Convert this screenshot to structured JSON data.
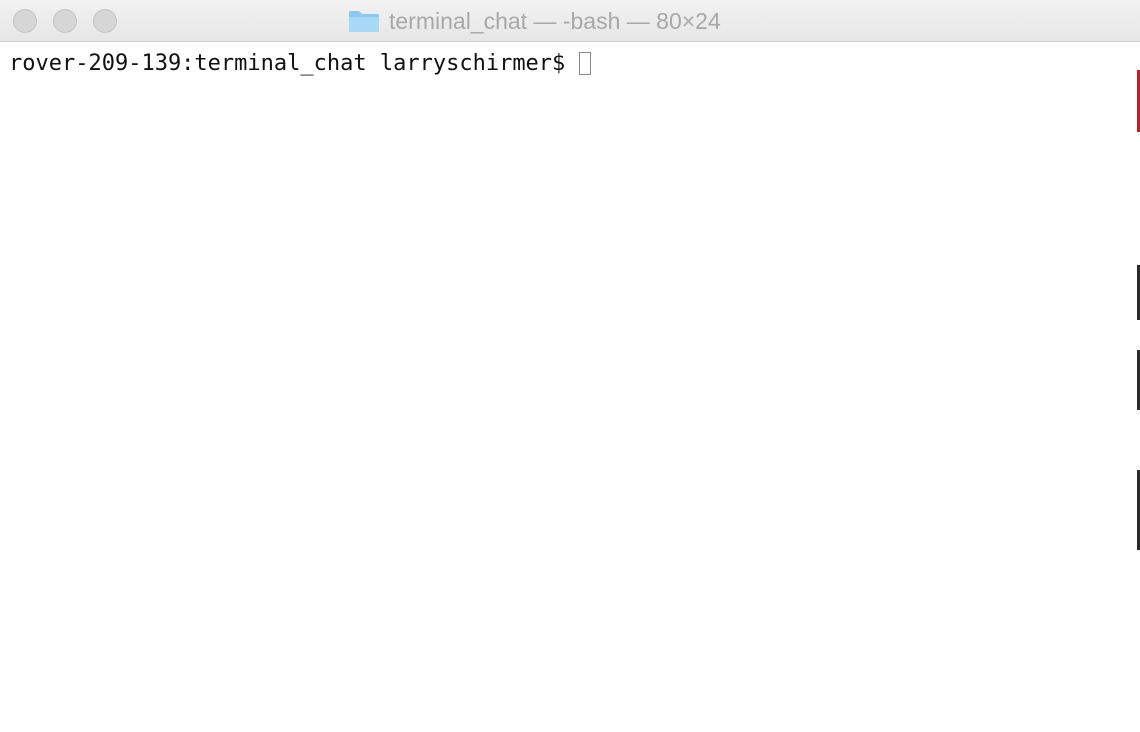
{
  "window": {
    "title": "terminal_chat — -bash — 80×24",
    "folder_icon": "folder-icon",
    "traffic_light_color": "#d6d6d6"
  },
  "terminal": {
    "prompt": "rover-209-139:terminal_chat larryschirmer$",
    "input": "",
    "text_color": "#111111",
    "background_color": "#ffffff"
  }
}
